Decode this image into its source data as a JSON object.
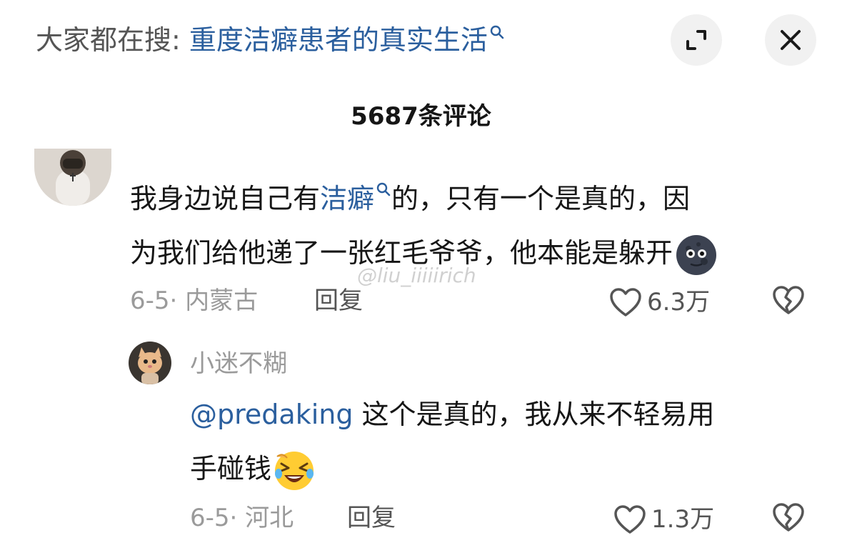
{
  "header": {
    "prefix": "大家都在搜: ",
    "query": "重度洁癖患者的真实生活",
    "expand_icon": "expand-icon",
    "close_icon": "close-icon"
  },
  "comment_count": "5687条评论",
  "comments": [
    {
      "text_line1_a": "我身边说自己有",
      "text_link": "洁癖",
      "text_line1_b": "的，只有一个是真的，因",
      "text_line2": "为我们给他递了一张红毛爷爷，他本能是躲开",
      "emoji": "new-moon-face-emoji",
      "date": "6-5",
      "location": "· 内蒙古",
      "reply_label": "回复",
      "likes": "6.3万",
      "reply": {
        "username": "小迷不糊",
        "mention": "@predaking",
        "text_line1": " 这个是真的，我从来不轻易用",
        "text_line2": "手碰钱",
        "emoji": "rolling-laughing-emoji",
        "date": "6-5",
        "location": "· 河北",
        "reply_label": "回复",
        "likes": "1.3万"
      }
    }
  ],
  "watermark": "@liu_iiiiirich",
  "colors": {
    "link": "#2b5f9e",
    "meta": "#9a9a9a",
    "button_bg": "#f1f1f1"
  }
}
